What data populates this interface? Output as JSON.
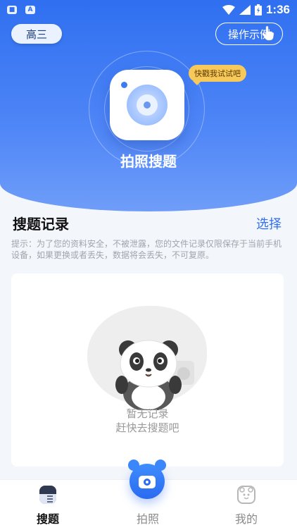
{
  "status_bar": {
    "time": "1:36",
    "left_icons": [
      "notification-icon",
      "a-icon"
    ],
    "right_icons": [
      "wifi-icon",
      "signal-icon",
      "battery-icon"
    ]
  },
  "header": {
    "grade": "高三",
    "demo_label": "操作示例",
    "tooltip": "快戳我试试吧",
    "title": "拍照搜题"
  },
  "records": {
    "title": "搜题记录",
    "select_label": "选择",
    "notice": "提示：为了您的资料安全，不被泄露，您的文件记录仅限保存于当前手机设备，如果更换或者丢失，数据将会丢失，不可复原。",
    "empty_line1": "暂无记录",
    "empty_line2": "赶快去搜题吧"
  },
  "tabbar": {
    "items": [
      {
        "label": "搜题",
        "icon": "search-doc-icon",
        "active": true
      },
      {
        "label": "拍照",
        "icon": "camera-icon",
        "active": false
      },
      {
        "label": "我的",
        "icon": "bear-face-icon",
        "active": false
      }
    ]
  },
  "colors": {
    "primary": "#2f6ff0",
    "tooltip": "#f7c95b",
    "background": "#f3f6fb"
  }
}
